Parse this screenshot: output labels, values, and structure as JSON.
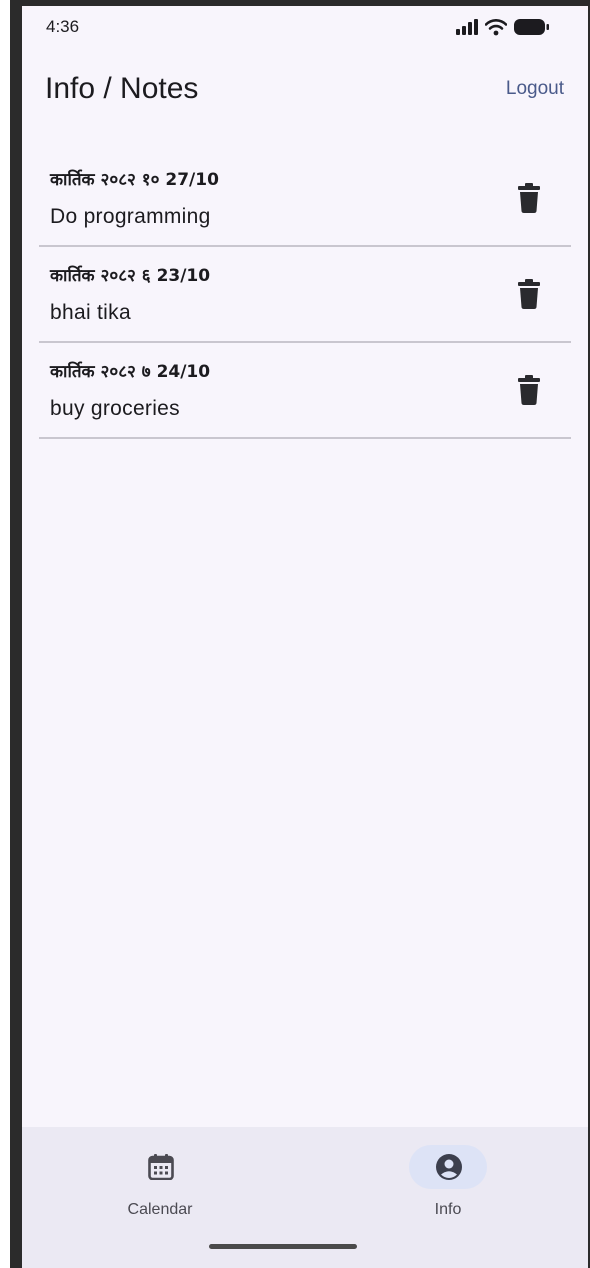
{
  "status_bar": {
    "time": "4:36",
    "icons": [
      "signal-icon",
      "wifi-icon",
      "battery-icon"
    ]
  },
  "app_bar": {
    "title": "Info / Notes",
    "logout_label": "Logout"
  },
  "notes": [
    {
      "date": "कार्तिक २०८२ १० 27/10",
      "text": "Do programming"
    },
    {
      "date": "कार्तिक २०८२ ६ 23/10",
      "text": "bhai tika"
    },
    {
      "date": "कार्तिक २०८२ ७ 24/10",
      "text": "buy groceries"
    }
  ],
  "bottom_nav": {
    "items": [
      {
        "label": "Calendar",
        "icon": "calendar-icon",
        "selected": false
      },
      {
        "label": "Info",
        "icon": "account-icon",
        "selected": true
      }
    ]
  },
  "colors": {
    "background": "#f8f5fc",
    "accent": "#4a5a8a",
    "nav_background": "#ebe9f3",
    "nav_selected_pill": "#dde3f6",
    "divider": "#c9c6cf"
  }
}
